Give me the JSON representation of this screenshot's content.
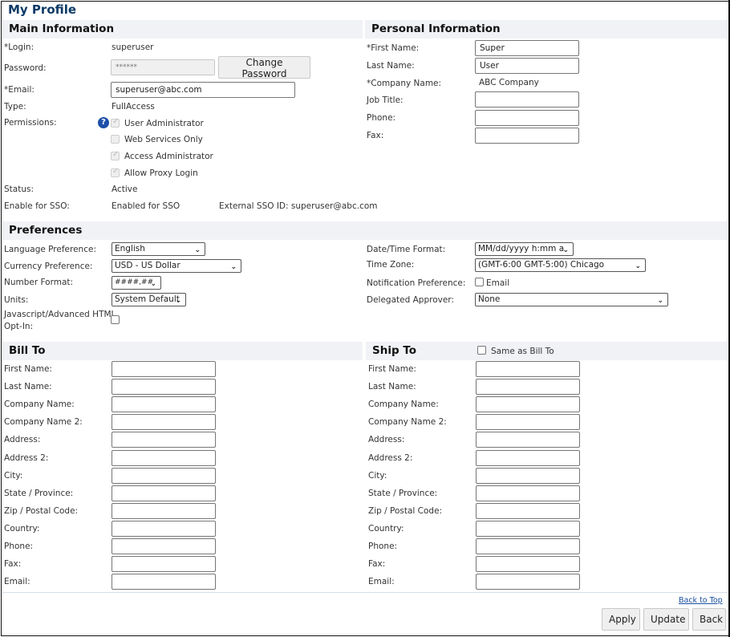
{
  "page_title": "My Profile",
  "main_info": {
    "heading": "Main Information",
    "login_label": "*Login:",
    "login_value": "superuser",
    "password_label": "Password:",
    "password_value": "******",
    "change_password_label": "Change Password",
    "email_label": "*Email:",
    "email_value": "superuser@abc.com",
    "type_label": "Type:",
    "type_value": "FullAccess",
    "permissions_label": "Permissions:",
    "help_icon": "?",
    "permissions": [
      {
        "label": "User Administrator",
        "checked": true
      },
      {
        "label": "Web Services Only",
        "checked": false
      },
      {
        "label": "Access Administrator",
        "checked": true
      },
      {
        "label": "Allow Proxy Login",
        "checked": true
      }
    ],
    "status_label": "Status:",
    "status_value": "Active",
    "sso_label": "Enable for SSO:",
    "sso_value": "Enabled for SSO",
    "external_sso": "External SSO ID: superuser@abc.com"
  },
  "personal_info": {
    "heading": "Personal Information",
    "first_name_label": "*First Name:",
    "first_name_value": "Super",
    "last_name_label": "Last Name:",
    "last_name_value": "User",
    "company_label": "*Company Name:",
    "company_value": "ABC Company",
    "job_title_label": "Job Title:",
    "job_title_value": "",
    "phone_label": "Phone:",
    "phone_value": "",
    "fax_label": "Fax:",
    "fax_value": ""
  },
  "preferences": {
    "heading": "Preferences",
    "language_label": "Language Preference:",
    "language_value": "English",
    "currency_label": "Currency Preference:",
    "currency_value": "USD - US Dollar",
    "number_format_label": "Number Format:",
    "number_format_value": "####,##",
    "units_label": "Units:",
    "units_value": "System Default",
    "js_optin_label_1": "Javascript/Advanced HTML",
    "js_optin_label_2": "Opt-In:",
    "js_optin_checked": false,
    "datetime_label": "Date/Time Format:",
    "datetime_value": "MM/dd/yyyy h:mm a",
    "timezone_label": "Time Zone:",
    "timezone_value": "(GMT-6:00 GMT-5:00) Chicago",
    "notification_label": "Notification Preference:",
    "notification_option": "Email",
    "notification_checked": false,
    "delegated_label": "Delegated Approver:",
    "delegated_value": "None"
  },
  "bill_to": {
    "heading": "Bill To",
    "fields": [
      {
        "label": "First Name:",
        "value": ""
      },
      {
        "label": "Last Name:",
        "value": ""
      },
      {
        "label": "Company Name:",
        "value": ""
      },
      {
        "label": "Company Name 2:",
        "value": ""
      },
      {
        "label": "Address:",
        "value": ""
      },
      {
        "label": "Address 2:",
        "value": ""
      },
      {
        "label": "City:",
        "value": ""
      },
      {
        "label": "State / Province:",
        "value": ""
      },
      {
        "label": "Zip / Postal Code:",
        "value": ""
      },
      {
        "label": "Country:",
        "value": ""
      },
      {
        "label": "Phone:",
        "value": ""
      },
      {
        "label": "Fax:",
        "value": ""
      },
      {
        "label": "Email:",
        "value": ""
      }
    ]
  },
  "ship_to": {
    "heading": "Ship To",
    "same_as_bill_label": "Same as Bill To",
    "same_as_bill_checked": false,
    "fields": [
      {
        "label": "First Name:",
        "value": ""
      },
      {
        "label": "Last Name:",
        "value": ""
      },
      {
        "label": "Company Name:",
        "value": ""
      },
      {
        "label": "Company Name 2:",
        "value": ""
      },
      {
        "label": "Address:",
        "value": ""
      },
      {
        "label": "Address 2:",
        "value": ""
      },
      {
        "label": "City:",
        "value": ""
      },
      {
        "label": "State / Province:",
        "value": ""
      },
      {
        "label": "Zip / Postal Code:",
        "value": ""
      },
      {
        "label": "Country:",
        "value": ""
      },
      {
        "label": "Phone:",
        "value": ""
      },
      {
        "label": "Fax:",
        "value": ""
      },
      {
        "label": "Email:",
        "value": ""
      }
    ]
  },
  "footer": {
    "back_to_top": "Back to Top",
    "apply_label": "Apply",
    "update_label": "Update",
    "back_label": "Back"
  },
  "colors": {
    "title": "#0b3a66",
    "section_bg": "#f1f2f6",
    "help_icon": "#1b4fa8",
    "link": "#1a4fa0"
  }
}
